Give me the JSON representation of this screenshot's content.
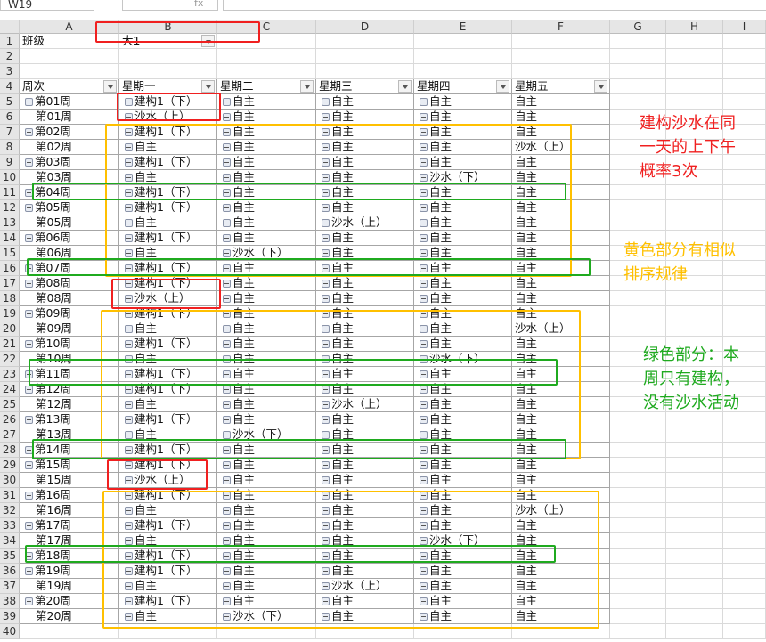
{
  "formula_bar": {
    "name_box": "W19",
    "fx": "fx"
  },
  "columns": [
    "A",
    "B",
    "C",
    "D",
    "E",
    "F",
    "G",
    "H",
    "I"
  ],
  "filter": {
    "label": "班级",
    "value": "大1"
  },
  "headers": [
    "周次",
    "星期一",
    "星期二",
    "星期三",
    "星期四",
    "星期五"
  ],
  "rows": [
    [
      "第01周",
      true,
      "建构1（下）",
      "自主",
      "自主",
      "自主",
      "自主"
    ],
    [
      "第01周",
      false,
      "沙水（上）",
      "自主",
      "自主",
      "自主",
      "自主"
    ],
    [
      "第02周",
      true,
      "建构1（下）",
      "自主",
      "自主",
      "自主",
      "自主"
    ],
    [
      "第02周",
      false,
      "自主",
      "自主",
      "自主",
      "自主",
      "沙水（上）"
    ],
    [
      "第03周",
      true,
      "建构1（下）",
      "自主",
      "自主",
      "自主",
      "自主"
    ],
    [
      "第03周",
      false,
      "自主",
      "自主",
      "自主",
      "沙水（下）",
      "自主"
    ],
    [
      "第04周",
      true,
      "建构1（下）",
      "自主",
      "自主",
      "自主",
      "自主"
    ],
    [
      "第05周",
      true,
      "建构1（下）",
      "自主",
      "自主",
      "自主",
      "自主"
    ],
    [
      "第05周",
      false,
      "自主",
      "自主",
      "沙水（上）",
      "自主",
      "自主"
    ],
    [
      "第06周",
      true,
      "建构1（下）",
      "自主",
      "自主",
      "自主",
      "自主"
    ],
    [
      "第06周",
      false,
      "自主",
      "沙水（下）",
      "自主",
      "自主",
      "自主"
    ],
    [
      "第07周",
      true,
      "建构1（下）",
      "自主",
      "自主",
      "自主",
      "自主"
    ],
    [
      "第08周",
      true,
      "建构1（下）",
      "自主",
      "自主",
      "自主",
      "自主"
    ],
    [
      "第08周",
      false,
      "沙水（上）",
      "自主",
      "自主",
      "自主",
      "自主"
    ],
    [
      "第09周",
      true,
      "建构1（下）",
      "自主",
      "自主",
      "自主",
      "自主"
    ],
    [
      "第09周",
      false,
      "自主",
      "自主",
      "自主",
      "自主",
      "沙水（上）"
    ],
    [
      "第10周",
      true,
      "建构1（下）",
      "自主",
      "自主",
      "自主",
      "自主"
    ],
    [
      "第10周",
      false,
      "自主",
      "自主",
      "自主",
      "沙水（下）",
      "自主"
    ],
    [
      "第11周",
      true,
      "建构1（下）",
      "自主",
      "自主",
      "自主",
      "自主"
    ],
    [
      "第12周",
      true,
      "建构1（下）",
      "自主",
      "自主",
      "自主",
      "自主"
    ],
    [
      "第12周",
      false,
      "自主",
      "自主",
      "沙水（上）",
      "自主",
      "自主"
    ],
    [
      "第13周",
      true,
      "建构1（下）",
      "自主",
      "自主",
      "自主",
      "自主"
    ],
    [
      "第13周",
      false,
      "自主",
      "沙水（下）",
      "自主",
      "自主",
      "自主"
    ],
    [
      "第14周",
      true,
      "建构1（下）",
      "自主",
      "自主",
      "自主",
      "自主"
    ],
    [
      "第15周",
      true,
      "建构1（下）",
      "自主",
      "自主",
      "自主",
      "自主"
    ],
    [
      "第15周",
      false,
      "沙水（上）",
      "自主",
      "自主",
      "自主",
      "自主"
    ],
    [
      "第16周",
      true,
      "建构1（下）",
      "自主",
      "自主",
      "自主",
      "自主"
    ],
    [
      "第16周",
      false,
      "自主",
      "自主",
      "自主",
      "自主",
      "沙水（上）"
    ],
    [
      "第17周",
      true,
      "建构1（下）",
      "自主",
      "自主",
      "自主",
      "自主"
    ],
    [
      "第17周",
      false,
      "自主",
      "自主",
      "自主",
      "沙水（下）",
      "自主"
    ],
    [
      "第18周",
      true,
      "建构1（下）",
      "自主",
      "自主",
      "自主",
      "自主"
    ],
    [
      "第19周",
      true,
      "建构1（下）",
      "自主",
      "自主",
      "自主",
      "自主"
    ],
    [
      "第19周",
      false,
      "自主",
      "自主",
      "沙水（上）",
      "自主",
      "自主"
    ],
    [
      "第20周",
      true,
      "建构1（下）",
      "自主",
      "自主",
      "自主",
      "自主"
    ],
    [
      "第20周",
      false,
      "自主",
      "沙水（下）",
      "自主",
      "自主",
      "自主"
    ]
  ],
  "annotations": {
    "red_note": [
      "建构沙水在同",
      "一天的上下午",
      "概率3次"
    ],
    "orange_note": [
      "黄色部分有相似",
      "排序规律"
    ],
    "green_note": [
      "绿色部分：本",
      "周只有建构，",
      "没有沙水活动"
    ],
    "colors": {
      "red": "#f02020",
      "orange": "#ffc000",
      "green": "#1faa1f"
    }
  }
}
